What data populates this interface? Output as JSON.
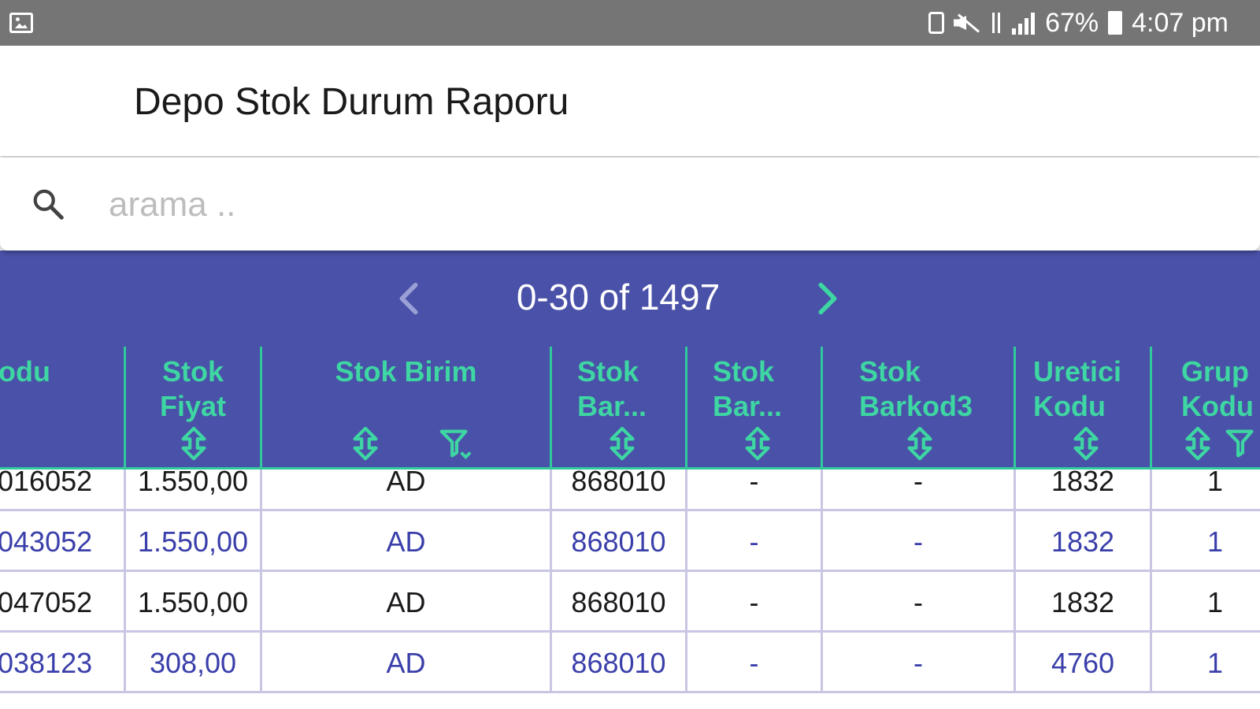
{
  "status_bar": {
    "battery": "67%",
    "time": "4:07 pm",
    "icons": [
      "gallery-icon",
      "lock-icon",
      "mute-icon",
      "data-icon",
      "signal-icon",
      "battery-icon"
    ]
  },
  "app_bar": {
    "title": "Depo Stok Durum Raporu"
  },
  "search": {
    "placeholder": "arama ..",
    "value": ""
  },
  "pager": {
    "range_text": "0-30 of 1497"
  },
  "table": {
    "columns": [
      {
        "label": "odu"
      },
      {
        "label": "Stok\nFiyat"
      },
      {
        "label": "Stok Birim"
      },
      {
        "label": "Stok\nBar..."
      },
      {
        "label": "Stok\nBar..."
      },
      {
        "label": "Stok\nBarkod3"
      },
      {
        "label": "Uretici\nKodu"
      },
      {
        "label": "Grup\nKodu"
      }
    ],
    "rows": [
      [
        "016052",
        "1.550,00",
        "AD",
        "868010",
        "-",
        "-",
        "1832",
        "1"
      ],
      [
        "043052",
        "1.550,00",
        "AD",
        "868010",
        "-",
        "-",
        "1832",
        "1"
      ],
      [
        "047052",
        "1.550,00",
        "AD",
        "868010",
        "-",
        "-",
        "1832",
        "1"
      ],
      [
        "038123",
        "308,00",
        "AD",
        "868010",
        "-",
        "-",
        "4760",
        "1"
      ]
    ]
  },
  "colors": {
    "primary": "#4a51a8",
    "accent": "#3ed6a2",
    "status_bar": "#757575",
    "alt_row_text": "#3a3faa"
  }
}
